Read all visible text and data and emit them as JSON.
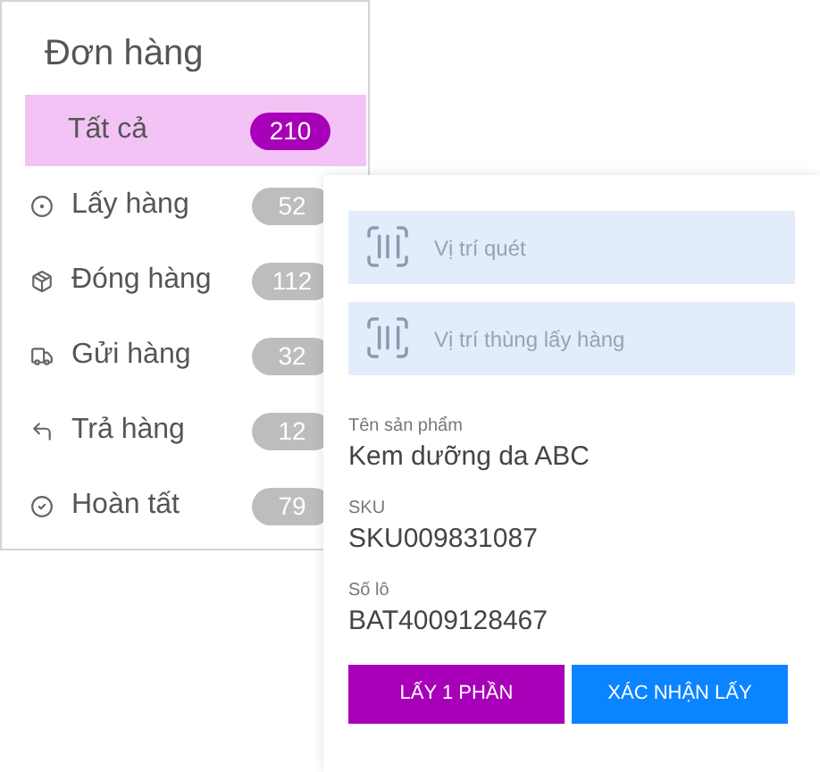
{
  "sidebar": {
    "title": "Đơn hàng",
    "items": [
      {
        "kind": "all",
        "label": "Tất cả",
        "count": "210",
        "selected": true
      },
      {
        "kind": "pick",
        "label": "Lấy hàng",
        "count": "52",
        "selected": false
      },
      {
        "kind": "pack",
        "label": "Đóng hàng",
        "count": "112",
        "selected": false
      },
      {
        "kind": "ship",
        "label": "Gửi hàng",
        "count": "32",
        "selected": false
      },
      {
        "kind": "return",
        "label": "Trả hàng",
        "count": "12",
        "selected": false
      },
      {
        "kind": "done",
        "label": "Hoàn tất",
        "count": "79",
        "selected": false
      }
    ]
  },
  "pick_panel": {
    "scan_fields": [
      {
        "placeholder": "Vị trí quét"
      },
      {
        "placeholder": "Vị trí thùng lấy hàng"
      }
    ],
    "details": [
      {
        "label": "Tên sản phẩm",
        "value": "Kem dưỡng da ABC"
      },
      {
        "label": "SKU",
        "value": "SKU009831087"
      },
      {
        "label": "Số lô",
        "value": "BAT4009128467"
      }
    ],
    "buttons": [
      {
        "kind": "partial",
        "label": "LẤY 1 PHẦN"
      },
      {
        "kind": "confirm",
        "label": "XÁC NHẬN LẤY"
      }
    ]
  }
}
